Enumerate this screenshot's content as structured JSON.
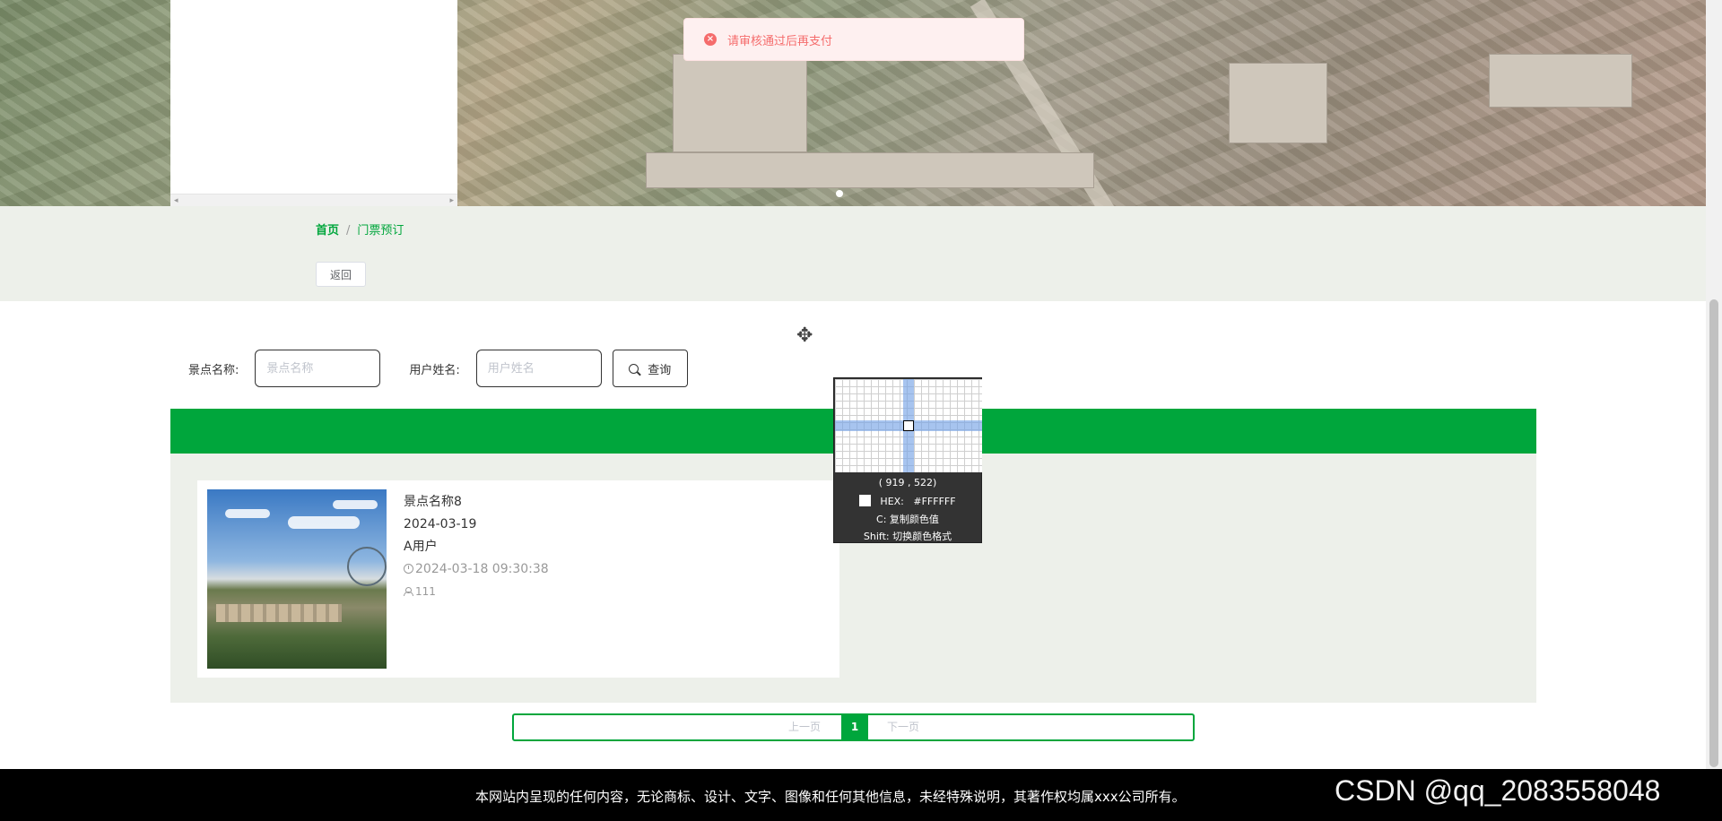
{
  "toast": {
    "icon": "error-circle-icon",
    "message": "请审核通过后再支付"
  },
  "breadcrumb": {
    "home": "首页",
    "separator": "/",
    "current": "门票预订"
  },
  "back_button": "返回",
  "search": {
    "attraction_label": "景点名称:",
    "attraction_placeholder": "景点名称",
    "user_label": "用户姓名:",
    "user_placeholder": "用户姓名",
    "query_label": "查询"
  },
  "list": [
    {
      "title": "景点名称8",
      "date": "2024-03-19",
      "user": "A用户",
      "created": "2024-03-18 09:30:38",
      "views": "111"
    }
  ],
  "color_picker": {
    "coords": "( 919 ,  522)",
    "hex_label": "HEX:",
    "hex_value": "#FFFFFF",
    "copy_hint": "C: 复制颜色值",
    "shift_hint": "Shift: 切换颜色格式"
  },
  "pagination": {
    "prev": "上一页",
    "current": "1",
    "next": "下一页"
  },
  "footer": {
    "text": "本网站内呈现的任何内容，无论商标、设计、文字、图像和任何其他信息，未经特殊说明，其著作权均属xxx公司所有。",
    "watermark": "CSDN @qq_2083558048"
  },
  "colors": {
    "accent": "#00a63c",
    "band": "#edf0ea",
    "error": "#f56c6c"
  }
}
